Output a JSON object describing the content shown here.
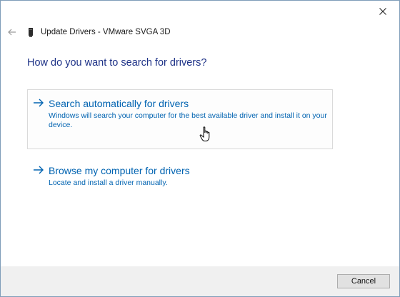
{
  "window": {
    "title": "Update Drivers - VMware SVGA 3D",
    "close_icon": "close-icon",
    "back_icon": "back-arrow-icon",
    "device_icon": "display-adapter-icon"
  },
  "main": {
    "question": "How do you want to search for drivers?",
    "options": [
      {
        "heading": "Search automatically for drivers",
        "description": "Windows will search your computer for the best available driver and install it on your device.",
        "hovered": true
      },
      {
        "heading": "Browse my computer for drivers",
        "description": "Locate and install a driver manually.",
        "hovered": false
      }
    ]
  },
  "footer": {
    "cancel_label": "Cancel"
  },
  "colors": {
    "link_blue": "#0063b1",
    "heading_blue": "#1e3287",
    "footer_bg": "#f0f0f0"
  }
}
